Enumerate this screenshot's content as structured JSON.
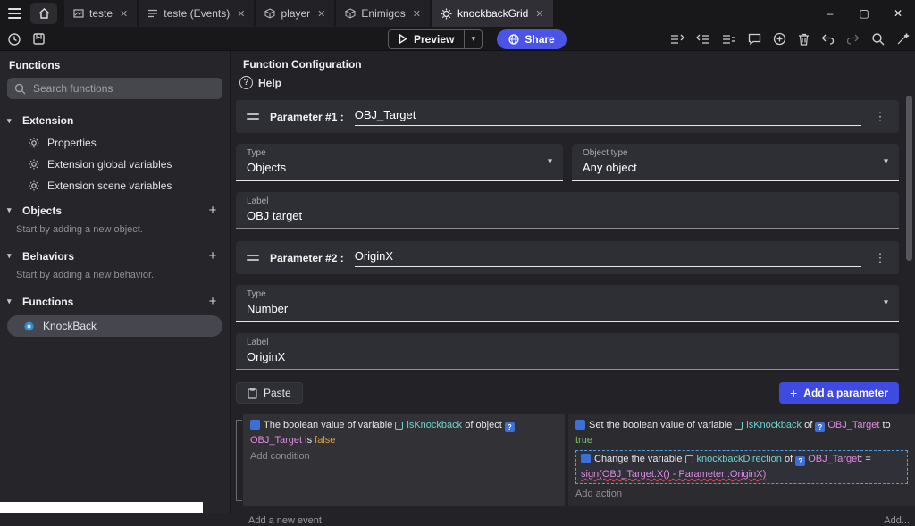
{
  "icons": {
    "close": "✕",
    "minimize": "–",
    "maximize": "▢",
    "chevron_down": "▾",
    "caret": "▾",
    "plus": "+",
    "kebab": "⋮",
    "question": "?",
    "play": "▶"
  },
  "colors": {
    "accent": "#4a55e8",
    "add_parameter_button": "#3f4ae0",
    "variable_text": "#6fd3cf",
    "object_text": "#df8be0",
    "true_text": "#7bc862",
    "false_text": "#e0a43c"
  },
  "window": {
    "tabs": [
      {
        "label": "teste"
      },
      {
        "label": "teste (Events)"
      },
      {
        "label": "player"
      },
      {
        "label": "Enimigos"
      },
      {
        "label": "knockbackGrid"
      }
    ]
  },
  "toolbar": {
    "preview": "Preview",
    "share": "Share"
  },
  "sidebar": {
    "title": "Functions",
    "search_placeholder": "Search functions",
    "extension": {
      "label": "Extension",
      "items": [
        "Properties",
        "Extension global variables",
        "Extension scene variables"
      ]
    },
    "objects": {
      "label": "Objects",
      "caption": "Start by adding a new object."
    },
    "behaviors": {
      "label": "Behaviors",
      "caption": "Start by adding a new behavior."
    },
    "functions": {
      "label": "Functions",
      "items": [
        "KnockBack"
      ]
    }
  },
  "main": {
    "title": "Function Configuration",
    "help": "Help",
    "param1": {
      "header": "Parameter #1 :",
      "name": "OBJ_Target",
      "type_label": "Type",
      "type_value": "Objects",
      "objtype_label": "Object type",
      "objtype_value": "Any object",
      "label_label": "Label",
      "label_value": "OBJ target"
    },
    "param2": {
      "header": "Parameter #2 :",
      "name": "OriginX",
      "type_label": "Type",
      "type_value": "Number",
      "label_label": "Label",
      "label_value": "OriginX"
    },
    "paste": "Paste",
    "add_parameter": "Add a parameter",
    "events": {
      "cond1": {
        "t1": "The boolean value of variable ",
        "var": "isKnockback",
        "t2": " of object ",
        "obj": "OBJ_Target",
        "t3": " is ",
        "val": "false"
      },
      "add_condition": "Add condition",
      "act1": {
        "t1": "Set the boolean value of variable ",
        "var": "isKnockback",
        "t2": " of ",
        "obj": "OBJ_Target",
        "t3": " to ",
        "val": "true"
      },
      "act2": {
        "t1": "Change the variable ",
        "var": "knockbackDirection",
        "t2": " of ",
        "obj": "OBJ_Target",
        "t3": ": = ",
        "expr": "sign(OBJ_Target.X() - Parameter::OriginX)"
      },
      "add_action": "Add action",
      "add_new_event": "Add a new event",
      "add_more": "Add..."
    }
  }
}
